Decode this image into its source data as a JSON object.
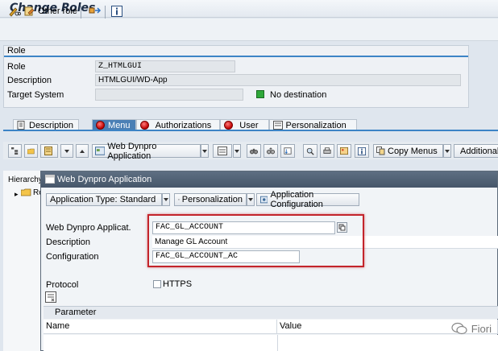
{
  "window": {
    "title": "Change Roles"
  },
  "toolbar": {
    "other_role_label": "Other role"
  },
  "role_panel": {
    "header": "Role",
    "fields": [
      {
        "label": "Role",
        "value": "Z_HTMLGUI"
      },
      {
        "label": "Description",
        "value": "HTMLGUI/WD-App"
      },
      {
        "label": "Target System",
        "value": ""
      }
    ],
    "destination_status": "No destination",
    "destination_color": "#2fa83a"
  },
  "tabs": [
    {
      "label": "Description"
    },
    {
      "label": "Menu"
    },
    {
      "label": "Authorizations"
    },
    {
      "label": "User"
    },
    {
      "label": "Personalization"
    }
  ],
  "menu_toolbar": {
    "web_dynpro_app_label": "Web Dynpro Application",
    "copy_menus_label": "Copy Menus",
    "additional_label": "Additional A"
  },
  "hierarchy": {
    "header": "Hierarchy",
    "node_label": "Ro"
  },
  "popup": {
    "title": "Web Dynpro Application",
    "app_type_label": "Application Type: Standard",
    "personalization_label": "Personalization",
    "app_config_label": "Application Configuration",
    "fields": {
      "webdynpro_label": "Web Dynpro Applicat.",
      "webdynpro_value": "FAC_GL_ACCOUNT",
      "description_label": "Description",
      "description_value": "Manage GL Account",
      "configuration_label": "Configuration",
      "configuration_value": "FAC_GL_ACCOUNT_AC"
    },
    "protocol_label": "Protocol",
    "https_label": "HTTPS",
    "parameter_header": "Parameter",
    "columns": [
      "Name",
      "Value"
    ]
  },
  "watermark": "Fiori",
  "colors": {
    "highlight_frame": "#c3242b",
    "active_tab": "#4a7fb5"
  }
}
